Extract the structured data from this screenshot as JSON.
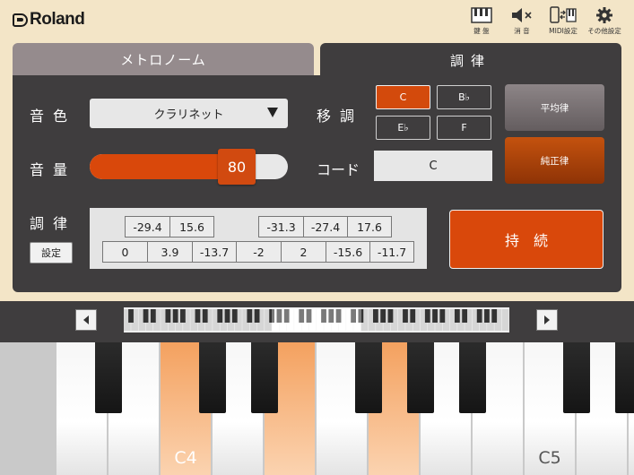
{
  "header": {
    "brand": "Roland",
    "buttons": [
      {
        "label": "鍵 盤",
        "icon": "keyboard-icon"
      },
      {
        "label": "消 音",
        "icon": "mute-icon"
      },
      {
        "label": "MIDI設定",
        "icon": "midi-icon"
      },
      {
        "label": "その他設定",
        "icon": "gear-icon"
      }
    ]
  },
  "tabs": [
    {
      "label": "メトロノーム",
      "active": false
    },
    {
      "label": "調律",
      "active": true
    }
  ],
  "tuning": {
    "tone_label": "音色",
    "tone_value": "クラリネット",
    "volume_label": "音量",
    "volume_value": "80",
    "volume_fraction": 0.8,
    "transpose_label": "移調",
    "transpose_options": [
      "C",
      "B♭",
      "E♭",
      "F"
    ],
    "transpose_selected": "C",
    "chord_label": "コード",
    "chord_value": "C",
    "temperament_label": "調律",
    "set_button": "設定",
    "equal_temperament": "平均律",
    "just_intonation": "純正律",
    "sustain_button": "持続",
    "cents_top": [
      "-29.4",
      "15.6",
      "-31.3",
      "-27.4",
      "17.6"
    ],
    "cents_bottom": [
      "0",
      "3.9",
      "-13.7",
      "-2",
      "2",
      "-15.6",
      "-11.7"
    ]
  },
  "keyboard": {
    "prev_icon": "triangle-left-icon",
    "next_icon": "triangle-right-icon",
    "c4_label": "C4",
    "c5_label": "C5",
    "highlighted_keys": [
      "C4",
      "E4",
      "G4"
    ],
    "colors": {
      "accent": "#d9480b",
      "highlight": "#f4a15f"
    }
  }
}
